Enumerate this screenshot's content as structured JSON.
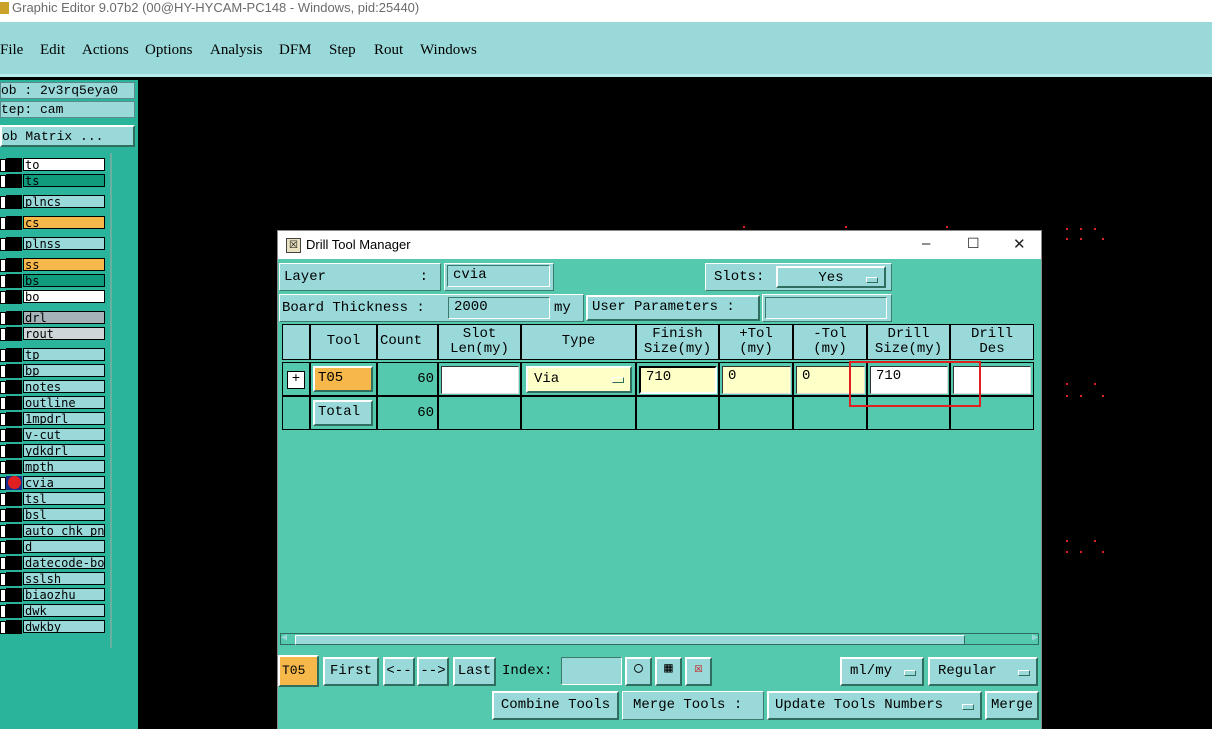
{
  "window": {
    "title": "Graphic Editor 9.07b2 (00@HY-HYCAM-PC148 - Windows, pid:25440)"
  },
  "menu": {
    "items": [
      "File",
      "Edit",
      "Actions",
      "Options",
      "Analysis",
      "DFM",
      "Step",
      "Rout",
      "Windows"
    ]
  },
  "left_panel": {
    "job": "ob : 2v3rq5eya0",
    "step": "tep: cam",
    "job_matrix": "ob Matrix ...",
    "layers": [
      {
        "name": "to",
        "color": "#ffffff"
      },
      {
        "name": "ts",
        "color": "#0f9b7c"
      },
      {
        "name": "plncs",
        "color": "#9ad9d9"
      },
      {
        "name": "cs",
        "color": "#f7b84b"
      },
      {
        "name": "plnss",
        "color": "#9ad9d9"
      },
      {
        "name": "ss",
        "color": "#f7b84b"
      },
      {
        "name": "bs",
        "color": "#0f9b7c"
      },
      {
        "name": "bo",
        "color": "#ffffff"
      },
      {
        "name": "drl",
        "color": "#a6b3b8"
      },
      {
        "name": "rout",
        "color": "#cfd6d8"
      },
      {
        "name": "tp",
        "color": "#9ad9d9"
      },
      {
        "name": "bp",
        "color": "#9ad9d9"
      },
      {
        "name": "notes",
        "color": "#9ad9d9"
      },
      {
        "name": "outline",
        "color": "#9ad9d9"
      },
      {
        "name": "1mpdrl",
        "color": "#9ad9d9"
      },
      {
        "name": "v-cut",
        "color": "#9ad9d9"
      },
      {
        "name": "ydkdrl",
        "color": "#9ad9d9"
      },
      {
        "name": "mpth",
        "color": "#9ad9d9"
      },
      {
        "name": "cvia",
        "color": "#9ad9d9"
      },
      {
        "name": "tsl",
        "color": "#9ad9d9"
      },
      {
        "name": "bsl",
        "color": "#9ad9d9"
      },
      {
        "name": "auto_chk_pn.",
        "color": "#9ad9d9"
      },
      {
        "name": "d",
        "color": "#9ad9d9"
      },
      {
        "name": "datecode-bo",
        "color": "#9ad9d9"
      },
      {
        "name": "sslsh",
        "color": "#9ad9d9"
      },
      {
        "name": "biaozhu",
        "color": "#9ad9d9"
      },
      {
        "name": "dwk",
        "color": "#9ad9d9"
      },
      {
        "name": "dwkby",
        "color": "#9ad9d9"
      }
    ]
  },
  "dialog": {
    "title": "Drill Tool Manager",
    "layer_label": "Layer",
    "layer_colon": ":",
    "layer_value": "cvia",
    "slots_label": "Slots:",
    "slots_value": "Yes",
    "board_thickness_label": "Board Thickness :",
    "board_thickness_value": "2000",
    "board_thickness_unit": "my",
    "user_params_label": "User Parameters :",
    "user_params_value": "",
    "table": {
      "headers": [
        "Tool",
        "Count",
        "Slot\nLen(my)",
        "Type",
        "Finish\nSize(my)",
        "+Tol\n(my)",
        "-Tol\n(my)",
        "Drill\nSize(my)",
        "Drill\nDes"
      ],
      "row": {
        "tool": "T05",
        "count": "60",
        "slot_len": "",
        "type": "Via",
        "finish_size": "710",
        "plus_tol": "0",
        "minus_tol": "0",
        "drill_size": "710",
        "drill_des": ""
      },
      "total_label": "Total",
      "total_count": "60"
    },
    "bottom": {
      "current_tool": "T05",
      "first": "First",
      "prev": "<--",
      "next": "-->",
      "last": "Last",
      "index_label": "Index:",
      "index_value": "",
      "units": "ml/my",
      "mode": "Regular",
      "combine_tools": "Combine Tools",
      "merge_tools_label": "Merge Tools :",
      "update_tools_numbers": "Update Tools Numbers",
      "merge": "Merge"
    }
  },
  "colors": {
    "accent_orange": "#f7b84b",
    "dialog_bg": "#55c9ad",
    "panel_bg": "#9ad9d9",
    "highlight_red": "#e02020"
  }
}
